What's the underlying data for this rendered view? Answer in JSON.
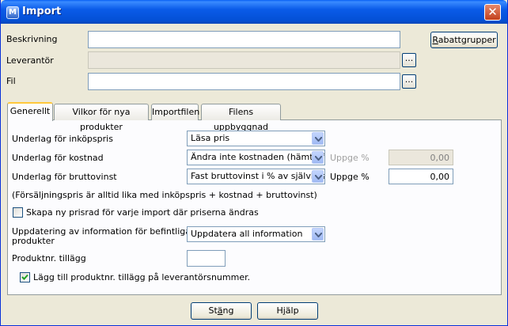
{
  "window": {
    "title": "Import",
    "close_icon": "close-icon"
  },
  "top_form": {
    "beskrivning_label": "Beskrivning",
    "beskrivning_value": "",
    "leverantor_label": "Leverantör",
    "leverantor_value": "",
    "fil_label": "Fil",
    "fil_value": "",
    "browse_label": "...",
    "rabatt_button_rest": "abattgrupper",
    "rabatt_button_accel": "R"
  },
  "tabs": [
    {
      "label": "Generellt",
      "active": true
    },
    {
      "label": "Vilkor för nya produkter",
      "active": false
    },
    {
      "label": "Importfilen",
      "active": false
    },
    {
      "label": "Filens uppbyggnad",
      "active": false
    }
  ],
  "general": {
    "inkopspris_label": "Underlag för inköpspris",
    "inkopspris_value": "Läsa pris",
    "kostnad_label": "Underlag för kostnad",
    "kostnad_value": "Ändra inte kostnaden (hämta frå",
    "kostnad_uppge_label": "Uppge %",
    "kostnad_uppge_value": "0,00",
    "bruttovinst_label": "Underlag för bruttovinst",
    "bruttovinst_value": "Fast bruttovinst i % av självkostr",
    "bruttovinst_uppge_label": "Uppge %",
    "bruttovinst_uppge_value": "0,00",
    "note": "(Försäljningspris är alltid lika med inköpspris + kostnad + bruttovinst)",
    "prisrad_label": "Skapa ny prisrad för varje import där priserna ändras",
    "prisrad_checked": false,
    "uppdatering_label_1": "Uppdatering av information för befintliga",
    "uppdatering_label_2": "produkter",
    "uppdatering_value": "Uppdatera all information",
    "tillagg_label": "Produktnr. tillägg",
    "tillagg_value": "",
    "lagg_till_label": "Lägg till produktnr. tillägg på leverantörsnummer.",
    "lagg_till_checked": true
  },
  "footer": {
    "stang_pre": "St",
    "stang_accel": "ä",
    "stang_post": "ng",
    "hjalp_pre": "H",
    "hjalp_accel": "j",
    "hjalp_post": "älp"
  }
}
